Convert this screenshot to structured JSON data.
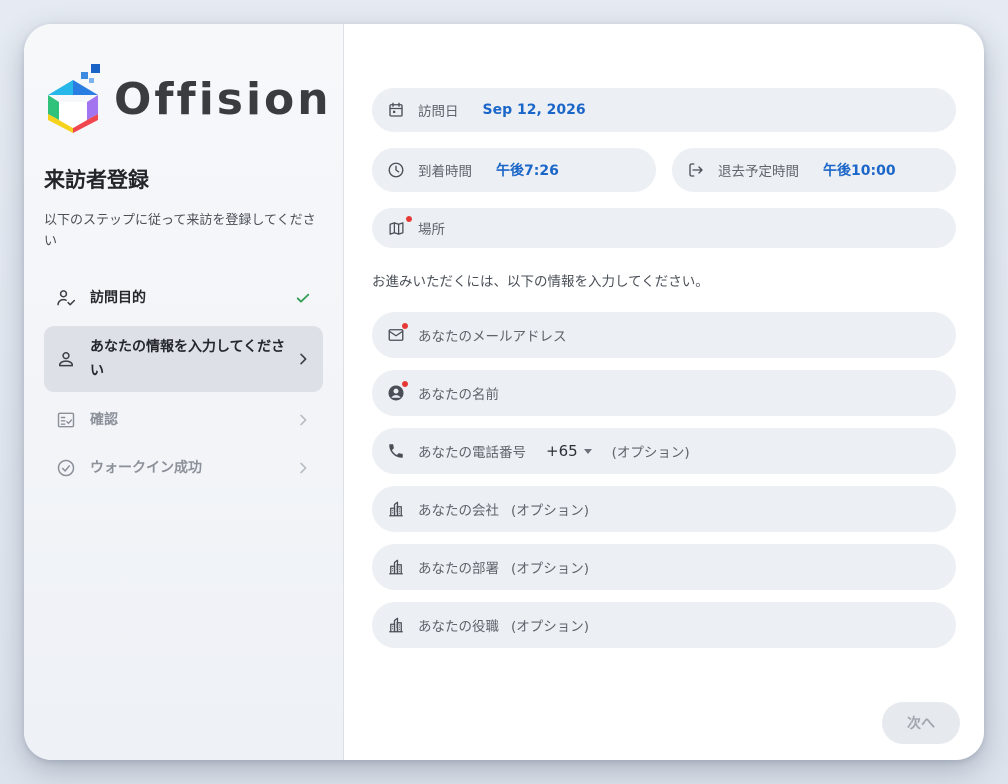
{
  "brand": {
    "name": "Offision"
  },
  "sidebar": {
    "title": "来訪者登録",
    "subtitle": "以下のステップに従って来訪を登録してください",
    "steps": [
      {
        "label": "訪問目的",
        "state": "done",
        "icon": "person-check-icon",
        "tail": "check-icon"
      },
      {
        "label": "あなたの情報を入力してください",
        "state": "active",
        "icon": "person-icon",
        "tail": "chevron-right-icon"
      },
      {
        "label": "確認",
        "state": "pending",
        "icon": "checklist-icon",
        "tail": "chevron-right-icon"
      },
      {
        "label": "ウォークイン成功",
        "state": "pending",
        "icon": "check-circle-icon",
        "tail": "chevron-right-icon"
      }
    ]
  },
  "form": {
    "visit_date": {
      "label": "訪問日",
      "value": "Sep 12, 2026"
    },
    "arrival_time": {
      "label": "到着時間",
      "value": "午後7:26"
    },
    "departure_time": {
      "label": "退去予定時間",
      "value": "午後10:00"
    },
    "location": {
      "label": "場所"
    },
    "hint": "お進みいただくには、以下の情報を入力してください。",
    "email": {
      "label": "あなたのメールアドレス"
    },
    "name": {
      "label": "あなたの名前"
    },
    "phone": {
      "label": "あなたの電話番号",
      "country_code": "+65",
      "optional": "(オプション)"
    },
    "company": {
      "label": "あなたの会社",
      "optional": "(オプション)"
    },
    "department": {
      "label": "あなたの部署",
      "optional": "(オプション)"
    },
    "position": {
      "label": "あなたの役職",
      "optional": "(オプション)"
    }
  },
  "actions": {
    "next_label": "次へ"
  },
  "colors": {
    "accent": "#1b66c9",
    "required": "#e53935",
    "success": "#2e9b4f",
    "field_bg": "#eceff3"
  }
}
